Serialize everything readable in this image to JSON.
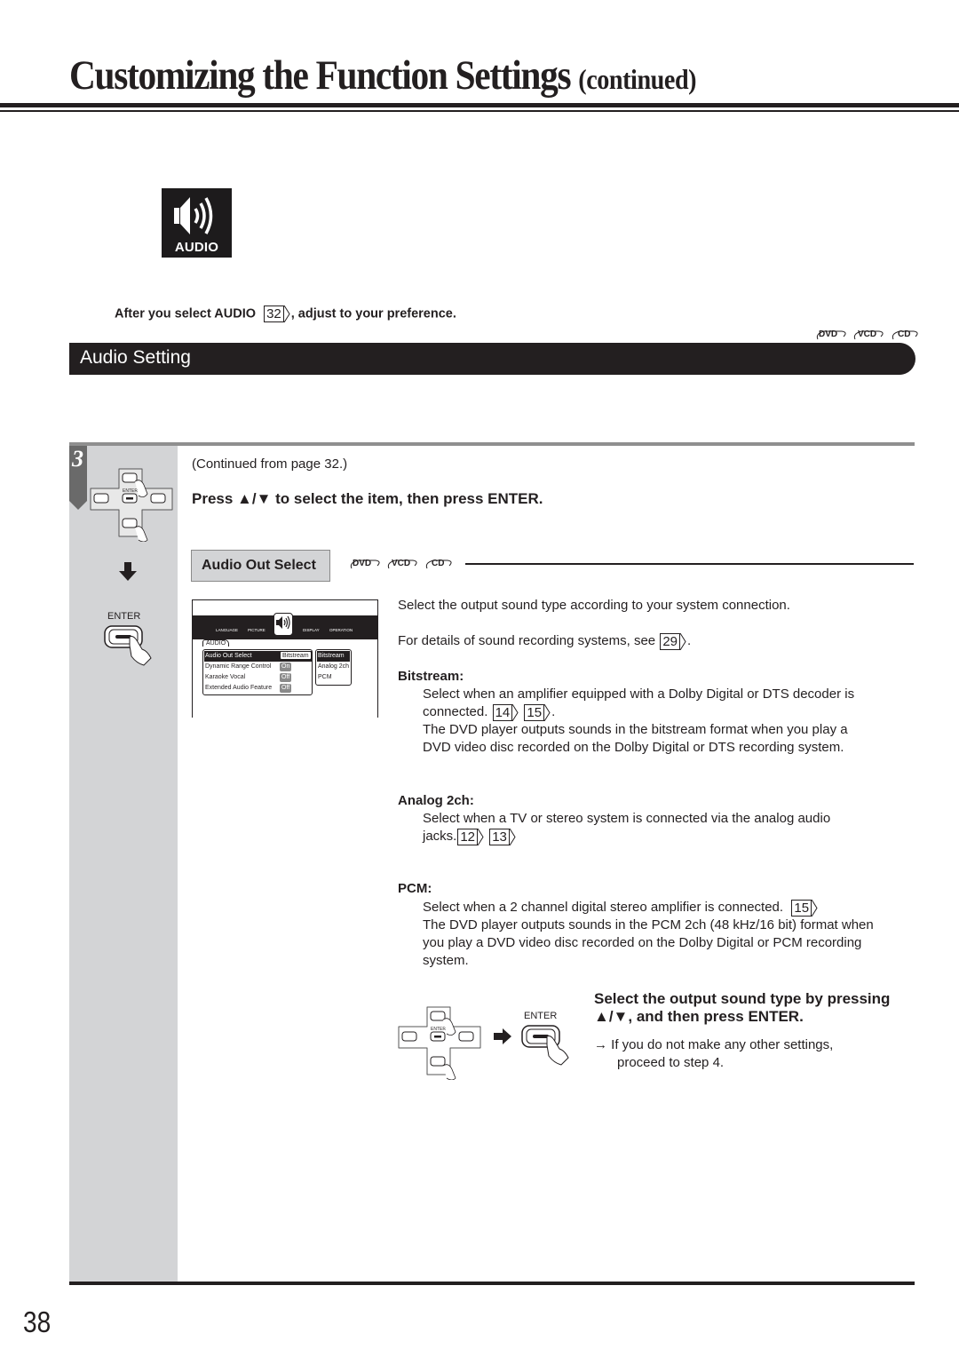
{
  "header": {
    "title": "Customizing the Function Settings",
    "title_suffix": "(continued)"
  },
  "audio_icon": {
    "label": "AUDIO",
    "icon": "speaker-icon"
  },
  "intro": {
    "before": "After you select AUDIO",
    "page_ref": "32",
    "after": ", adjust to your preference."
  },
  "section": {
    "title": "Audio Setting",
    "discs": [
      "DVD",
      "VCD",
      "CD"
    ]
  },
  "step": {
    "number": "3",
    "continued": "(Continued from page 32.)",
    "instruction": "Press ▲/▼ to select the item, then press ENTER.",
    "enter_label": "ENTER",
    "remote_enter_label": "ENTER"
  },
  "item": {
    "name": "Audio Out Select",
    "discs": [
      "DVD",
      "VCD",
      "CD"
    ]
  },
  "osd": {
    "tabs": [
      "LANGUAGE",
      "PICTURE",
      "AUDIO",
      "DISPLAY",
      "OPERATION"
    ],
    "active_tab": "AUDIO",
    "menu_tab": "AUDIO",
    "rows": [
      {
        "label": "Audio Out Select",
        "value": "Bitstream"
      },
      {
        "label": "Dynamic Range Control",
        "value": "On"
      },
      {
        "label": "Karaoke Vocal",
        "value": "Off"
      },
      {
        "label": "Extended Audio Feature",
        "value": "Off"
      }
    ],
    "options": [
      "Bitstream",
      "Analog 2ch",
      "PCM"
    ],
    "selected_option": "Bitstream"
  },
  "description": {
    "line1": "Select the output sound type according to your system connection.",
    "line2_before": "For details of sound recording systems, see",
    "line2_ref": "29",
    "line2_after": ".",
    "options": [
      {
        "heading": "Bitstream:",
        "lines": [
          "Select when an amplifier equipped with a Dolby Digital or DTS decoder is",
          "connected.",
          "The DVD player outputs sounds in the bitstream format when you play a",
          "DVD video disc recorded on the Dolby Digital or DTS recording system."
        ],
        "refs": [
          "14",
          "15"
        ]
      },
      {
        "heading": "Analog 2ch:",
        "lines": [
          "Select when a TV or stereo system is connected via the analog audio",
          "jacks."
        ],
        "refs": [
          "12",
          "13"
        ]
      },
      {
        "heading": "PCM:",
        "lines": [
          "Select when a 2 channel digital stereo amplifier is connected.",
          "The DVD player outputs sounds in the PCM 2ch (48 kHz/16 bit) format when",
          "you play a DVD video disc recorded on the Dolby Digital or PCM recording",
          "system."
        ],
        "refs": [
          "15"
        ]
      }
    ]
  },
  "final": {
    "heading1": "Select the output sound type by pressing",
    "heading2": "▲/▼, and then press ENTER.",
    "enter_label": "ENTER",
    "note1": "→  If you do not make any other settings,",
    "note2": "proceed to step 4."
  },
  "page_number": "38"
}
